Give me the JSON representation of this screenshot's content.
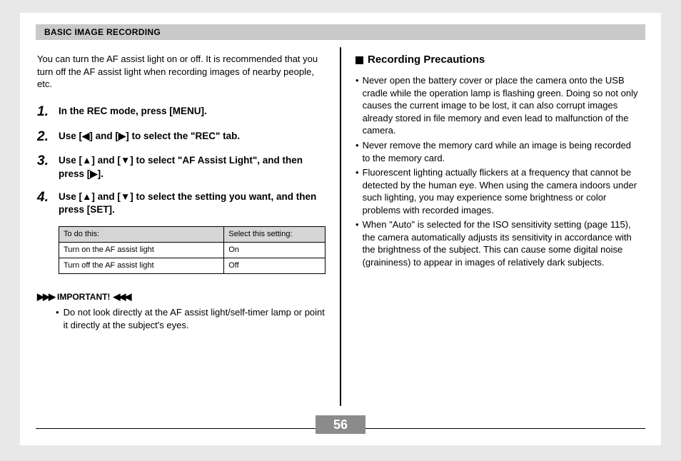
{
  "header": {
    "section_title": "BASIC IMAGE RECORDING"
  },
  "left": {
    "intro": "You can turn the AF assist light on or off. It is recommended that you turn off the AF assist light when recording images of nearby people, etc.",
    "steps": [
      {
        "num": "1.",
        "text": "In the REC mode, press [MENU]."
      },
      {
        "num": "2.",
        "text": "Use [◀] and [▶] to select the \"REC\" tab."
      },
      {
        "num": "3.",
        "text": "Use [▲] and [▼] to select \"AF Assist Light\", and then press [▶]."
      },
      {
        "num": "4.",
        "text": "Use [▲] and [▼] to select the setting you want, and then press [SET]."
      }
    ],
    "table": {
      "h1": "To do this:",
      "h2": "Select this setting:",
      "rows": [
        {
          "a": "Turn on the AF assist light",
          "b": "On"
        },
        {
          "a": "Turn off the AF assist light",
          "b": "Off"
        }
      ]
    },
    "important_label": "IMPORTANT!",
    "important_body": "Do not look directly at the AF assist light/self-timer lamp or point it directly at the subject's eyes."
  },
  "right": {
    "subheading": "Recording Precautions",
    "bullets": [
      "Never open the battery cover or place the camera onto the USB cradle while the operation lamp is flashing green. Doing so not only causes the current image to be lost, it can also corrupt images already stored in file memory and even lead to malfunction of the camera.",
      "Never remove the memory card while an image is being recorded to the memory card.",
      "Fluorescent lighting actually flickers at a frequency that cannot be detected by the human eye. When using the camera indoors under such lighting, you may experience some brightness or color problems with recorded images.",
      "When \"Auto\" is selected for the ISO sensitivity setting (page 115), the camera automatically adjusts its sensitivity in accordance with the brightness of the subject. This can cause some digital noise (graininess) to appear in images of relatively dark subjects."
    ]
  },
  "page_number": "56"
}
